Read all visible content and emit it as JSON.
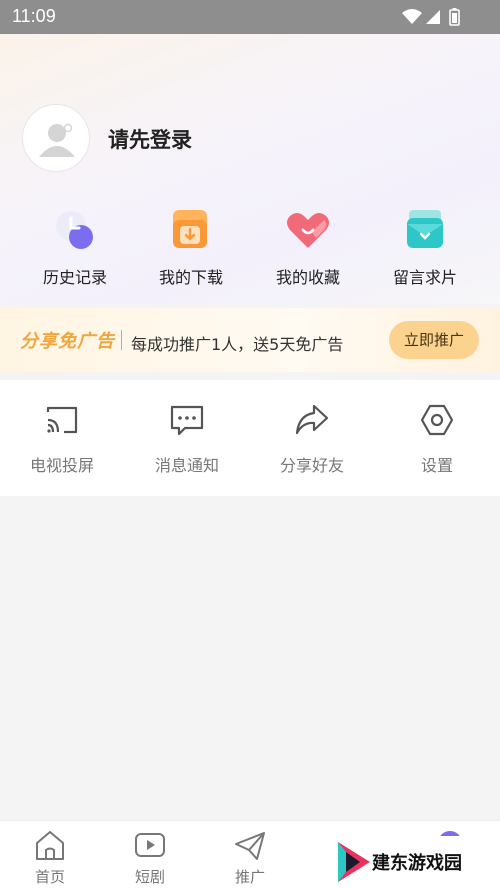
{
  "status_bar": {
    "time": "11:09"
  },
  "profile": {
    "login_prompt": "请先登录"
  },
  "quick_actions": [
    {
      "label": "历史记录",
      "icon": "history-icon",
      "color": "#7b6cf0"
    },
    {
      "label": "我的下载",
      "icon": "download-icon",
      "color": "#f7a14a"
    },
    {
      "label": "我的收藏",
      "icon": "favorite-icon",
      "color": "#f06a7a"
    },
    {
      "label": "留言求片",
      "icon": "message-request-icon",
      "color": "#2ec7c9"
    }
  ],
  "ad_banner": {
    "title": "分享免广告",
    "description": "每成功推广1人，送5天免广告",
    "button_label": "立即推广"
  },
  "tools": [
    {
      "label": "电视投屏",
      "icon": "cast-icon"
    },
    {
      "label": "消息通知",
      "icon": "message-icon"
    },
    {
      "label": "分享好友",
      "icon": "share-icon"
    },
    {
      "label": "设置",
      "icon": "settings-icon"
    }
  ],
  "bottom_nav": [
    {
      "label": "首页",
      "icon": "home-icon"
    },
    {
      "label": "短剧",
      "icon": "play-icon"
    },
    {
      "label": "推广",
      "icon": "send-icon"
    }
  ],
  "watermark": {
    "text": "建东游戏园"
  }
}
